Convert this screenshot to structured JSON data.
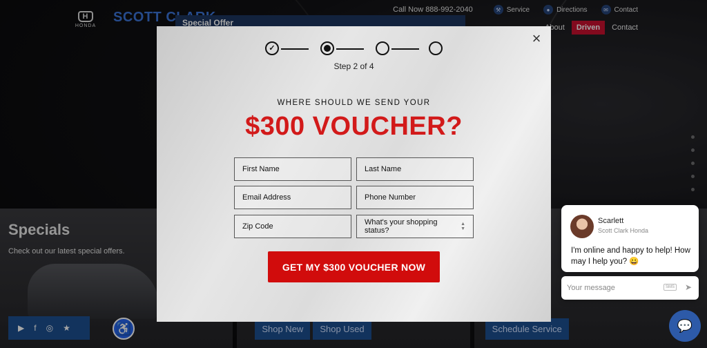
{
  "header": {
    "call_now": "Call Now 888-992-2040",
    "links": [
      {
        "label": "Service",
        "icon": "wrench-icon"
      },
      {
        "label": "Directions",
        "icon": "map-pin-icon"
      },
      {
        "label": "Contact",
        "icon": "mail-icon"
      }
    ],
    "honda_brand": "HONDA",
    "dealer_brand": "SCOTT CLARK",
    "nav": {
      "about": "About",
      "driven": "Driven",
      "contact": "Contact"
    }
  },
  "background": {
    "special_offer": "Special Offer",
    "specials_title": "Specials",
    "specials_sub": "Check out our latest special offers.",
    "shop_new": "Shop New",
    "shop_used": "Shop Used",
    "schedule_service": "Schedule Service"
  },
  "modal": {
    "close_glyph": "×",
    "step_label": "Step 2 of 4",
    "heading_small": "WHERE SHOULD WE SEND YOUR",
    "heading_big": "$300 VOUCHER?",
    "fields": {
      "first_name": "First Name",
      "last_name": "Last Name",
      "email": "Email Address",
      "phone": "Phone Number",
      "zip": "Zip Code",
      "shopping_status": "What's your shopping status?"
    },
    "cta_label": "GET MY $300 VOUCHER NOW"
  },
  "chat": {
    "agent_name": "Scarlett",
    "agent_org": "Scott Clark Honda",
    "message": "I'm online and happy to help! How may I help you? 😀",
    "input_placeholder": "Your message",
    "sms_label": "SMS"
  },
  "colors": {
    "accent_red": "#d21a1a",
    "cta_red": "#d10c0c",
    "brand_blue": "#1d4f8f"
  }
}
